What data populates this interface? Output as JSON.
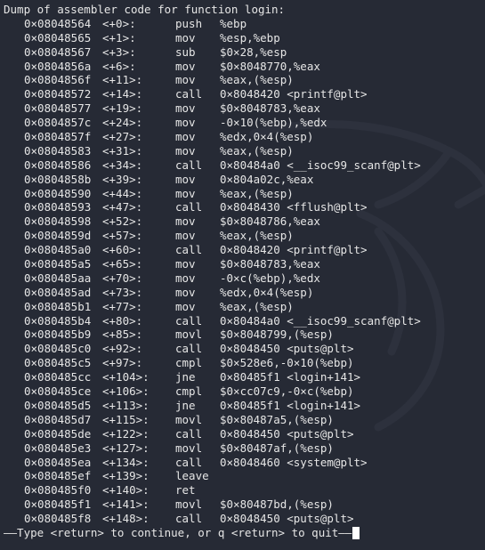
{
  "header": "Dump of assembler code for function login:",
  "instructions": [
    {
      "addr": "0×08048564",
      "off": "<+0>:",
      "op": "push",
      "args": "%ebp"
    },
    {
      "addr": "0×08048565",
      "off": "<+1>:",
      "op": "mov",
      "args": "%esp,%ebp"
    },
    {
      "addr": "0×08048567",
      "off": "<+3>:",
      "op": "sub",
      "args": "$0×28,%esp"
    },
    {
      "addr": "0×0804856a",
      "off": "<+6>:",
      "op": "mov",
      "args": "$0×8048770,%eax"
    },
    {
      "addr": "0×0804856f",
      "off": "<+11>:",
      "op": "mov",
      "args": "%eax,(%esp)"
    },
    {
      "addr": "0×08048572",
      "off": "<+14>:",
      "op": "call",
      "args": "0×8048420 <printf@plt>"
    },
    {
      "addr": "0×08048577",
      "off": "<+19>:",
      "op": "mov",
      "args": "$0×8048783,%eax"
    },
    {
      "addr": "0×0804857c",
      "off": "<+24>:",
      "op": "mov",
      "args": "-0×10(%ebp),%edx"
    },
    {
      "addr": "0×0804857f",
      "off": "<+27>:",
      "op": "mov",
      "args": "%edx,0×4(%esp)"
    },
    {
      "addr": "0×08048583",
      "off": "<+31>:",
      "op": "mov",
      "args": "%eax,(%esp)"
    },
    {
      "addr": "0×08048586",
      "off": "<+34>:",
      "op": "call",
      "args": "0×80484a0 <__isoc99_scanf@plt>"
    },
    {
      "addr": "0×0804858b",
      "off": "<+39>:",
      "op": "mov",
      "args": "0×804a02c,%eax"
    },
    {
      "addr": "0×08048590",
      "off": "<+44>:",
      "op": "mov",
      "args": "%eax,(%esp)"
    },
    {
      "addr": "0×08048593",
      "off": "<+47>:",
      "op": "call",
      "args": "0×8048430 <fflush@plt>"
    },
    {
      "addr": "0×08048598",
      "off": "<+52>:",
      "op": "mov",
      "args": "$0×8048786,%eax"
    },
    {
      "addr": "0×0804859d",
      "off": "<+57>:",
      "op": "mov",
      "args": "%eax,(%esp)"
    },
    {
      "addr": "0×080485a0",
      "off": "<+60>:",
      "op": "call",
      "args": "0×8048420 <printf@plt>"
    },
    {
      "addr": "0×080485a5",
      "off": "<+65>:",
      "op": "mov",
      "args": "$0×8048783,%eax"
    },
    {
      "addr": "0×080485aa",
      "off": "<+70>:",
      "op": "mov",
      "args": "-0×c(%ebp),%edx"
    },
    {
      "addr": "0×080485ad",
      "off": "<+73>:",
      "op": "mov",
      "args": "%edx,0×4(%esp)"
    },
    {
      "addr": "0×080485b1",
      "off": "<+77>:",
      "op": "mov",
      "args": "%eax,(%esp)"
    },
    {
      "addr": "0×080485b4",
      "off": "<+80>:",
      "op": "call",
      "args": "0×80484a0 <__isoc99_scanf@plt>"
    },
    {
      "addr": "0×080485b9",
      "off": "<+85>:",
      "op": "movl",
      "args": "$0×8048799,(%esp)"
    },
    {
      "addr": "0×080485c0",
      "off": "<+92>:",
      "op": "call",
      "args": "0×8048450 <puts@plt>"
    },
    {
      "addr": "0×080485c5",
      "off": "<+97>:",
      "op": "cmpl",
      "args": "$0×528e6,-0×10(%ebp)"
    },
    {
      "addr": "0×080485cc",
      "off": "<+104>:",
      "op": "jne",
      "args": "0×80485f1 <login+141>"
    },
    {
      "addr": "0×080485ce",
      "off": "<+106>:",
      "op": "cmpl",
      "args": "$0×cc07c9,-0×c(%ebp)"
    },
    {
      "addr": "0×080485d5",
      "off": "<+113>:",
      "op": "jne",
      "args": "0×80485f1 <login+141>"
    },
    {
      "addr": "0×080485d7",
      "off": "<+115>:",
      "op": "movl",
      "args": "$0×80487a5,(%esp)"
    },
    {
      "addr": "0×080485de",
      "off": "<+122>:",
      "op": "call",
      "args": "0×8048450 <puts@plt>"
    },
    {
      "addr": "0×080485e3",
      "off": "<+127>:",
      "op": "movl",
      "args": "$0×80487af,(%esp)"
    },
    {
      "addr": "0×080485ea",
      "off": "<+134>:",
      "op": "call",
      "args": "0×8048460 <system@plt>"
    },
    {
      "addr": "0×080485ef",
      "off": "<+139>:",
      "op": "leave",
      "args": ""
    },
    {
      "addr": "0×080485f0",
      "off": "<+140>:",
      "op": "ret",
      "args": ""
    },
    {
      "addr": "0×080485f1",
      "off": "<+141>:",
      "op": "movl",
      "args": "$0×80487bd,(%esp)"
    },
    {
      "addr": "0×080485f8",
      "off": "<+148>:",
      "op": "call",
      "args": "0×8048450 <puts@plt>"
    }
  ],
  "pager_prompt": "——Type <return> to continue, or q <return> to quit——",
  "colors": {
    "background": "#262a35",
    "text": "#e6e6e6",
    "cursor": "#ffffff"
  },
  "icons": {
    "watermark": "kali-dragon-icon",
    "cursor": "block-cursor"
  }
}
